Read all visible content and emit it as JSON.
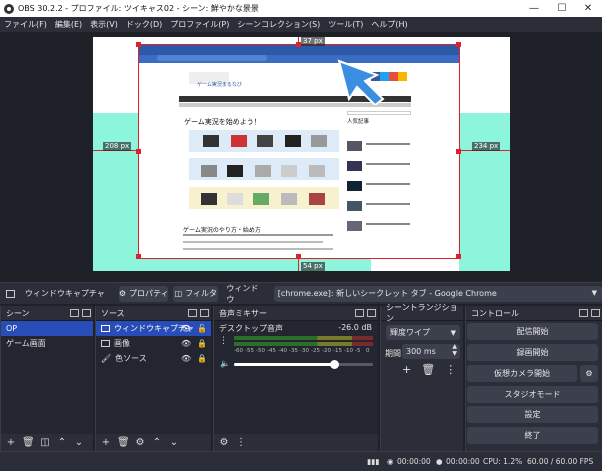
{
  "titlebar": {
    "title": "OBS 30.2.2 - プロファイル: ツイキャス02 - シーン: 鮮やかな景景"
  },
  "menu": [
    "ファイル(F)",
    "編集(E)",
    "表示(V)",
    "ドック(D)",
    "プロファイル(P)",
    "シーンコレクション(S)",
    "ツール(T)",
    "ヘルプ(H)"
  ],
  "preview": {
    "top_px": "37 px",
    "left_px": "208 px",
    "right_px": "234 px",
    "bottom_px": "54 px",
    "page": {
      "headline": "ゲーム実況を始めよう！",
      "subhead": "ゲーム実況のやり方・始め方",
      "side_title": "人気記事",
      "site": "ゲーム実況まるなび"
    }
  },
  "source_bar": {
    "name": "ウィンドウキャプチャ",
    "properties": "プロパティ",
    "filters": "フィルタ",
    "window_label": "ウィンドウ",
    "window_value": "[chrome.exe]: 新しいシークレット タブ - Google Chrome"
  },
  "scenes": {
    "title": "シーン",
    "items": [
      "OP",
      "ゲーム画面"
    ]
  },
  "sources": {
    "title": "ソース",
    "items": [
      "ウィンドウキャプチャ",
      "画像",
      "色ソース"
    ]
  },
  "mixer": {
    "title": "音声ミキサー",
    "channel": "デスクトップ音声",
    "db": "-26.0 dB",
    "ticks": [
      "-60",
      "-55",
      "-50",
      "-45",
      "-40",
      "-35",
      "-30",
      "-25",
      "-20",
      "-15",
      "-10",
      "-5",
      "0"
    ],
    "level": 0.72
  },
  "transitions": {
    "title": "シーントランジション",
    "type": "輝度ワイプ",
    "duration_label": "期間",
    "duration": "300 ms"
  },
  "controls": {
    "title": "コントロール",
    "buttons": [
      "配信開始",
      "録画開始",
      "仮想カメラ開始",
      "スタジオモード",
      "設定",
      "終了"
    ]
  },
  "status": {
    "stream_time": "00:00:00",
    "rec_time": "00:00:00",
    "cpu": "CPU: 1.2%",
    "fps": "60.00 / 60.00 FPS"
  }
}
